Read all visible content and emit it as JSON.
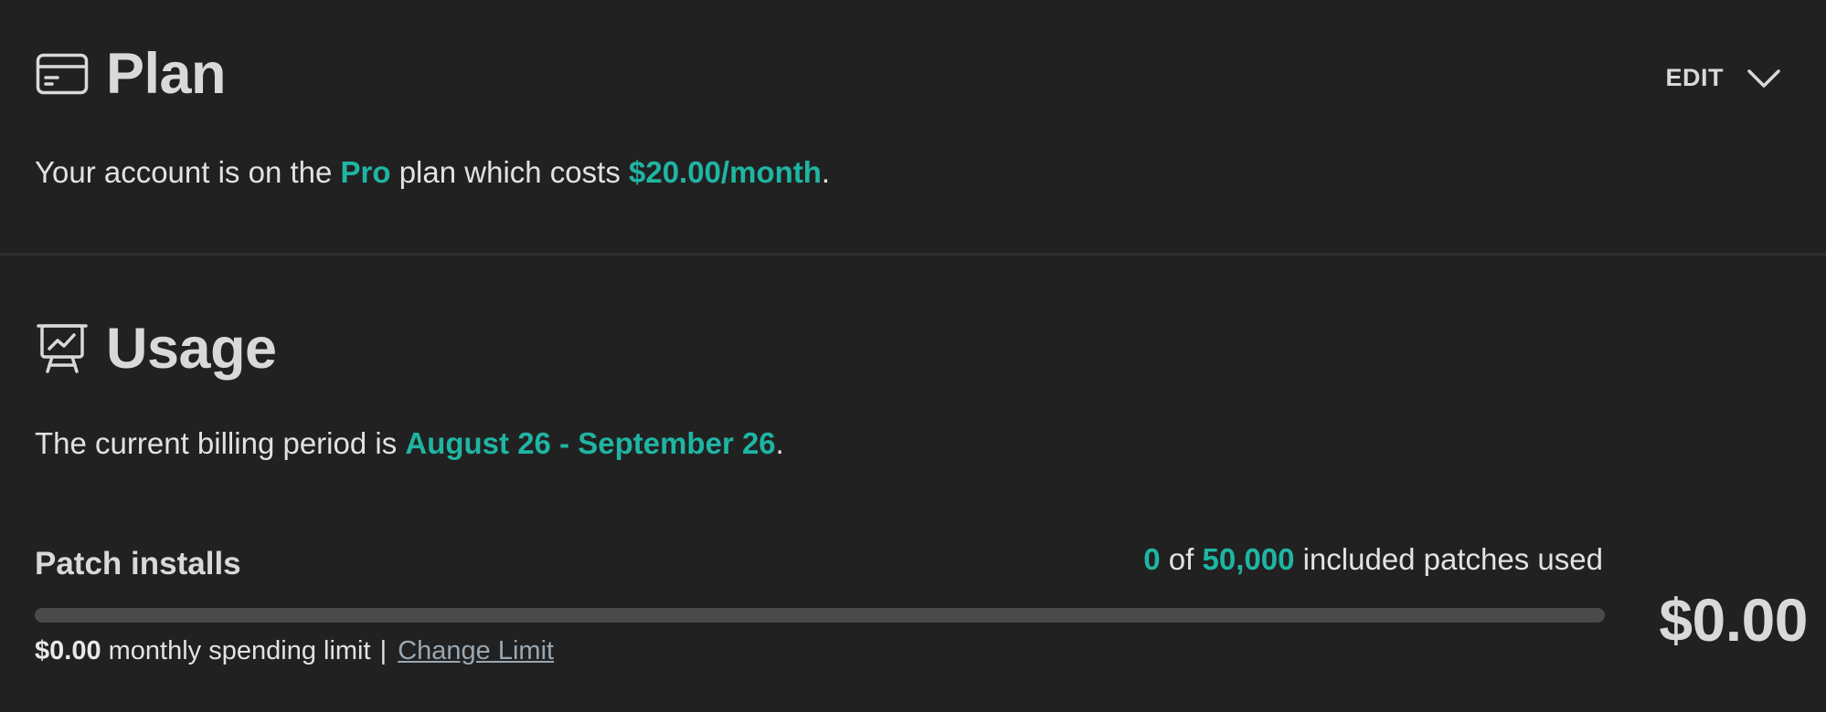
{
  "plan": {
    "title": "Plan",
    "icon": "credit-card-icon",
    "edit_label": "EDIT",
    "edit_icon": "chevron-down-icon",
    "sentence_prefix": "Your account is on the ",
    "plan_name": "Pro",
    "sentence_middle": " plan which costs ",
    "price": "$20.00/month",
    "sentence_suffix": "."
  },
  "usage": {
    "title": "Usage",
    "icon": "presentation-chart-icon",
    "sentence_prefix": "The current billing period is ",
    "period": "August 26 - September 26",
    "sentence_suffix": ".",
    "meter": {
      "label": "Patch installs",
      "used": "0",
      "of_text": " of ",
      "included": "50,000",
      "suffix": " included patches used",
      "progress_fraction": 0,
      "limit_amount": "$0.00",
      "limit_text": " monthly spending limit ",
      "separator": "|",
      "change_limit_label": "Change Limit",
      "total_cost": "$0.00"
    }
  },
  "colors": {
    "background": "#212121",
    "accent": "#1fb5a3",
    "track": "#4a4a4a",
    "link": "#9aa7b1"
  }
}
